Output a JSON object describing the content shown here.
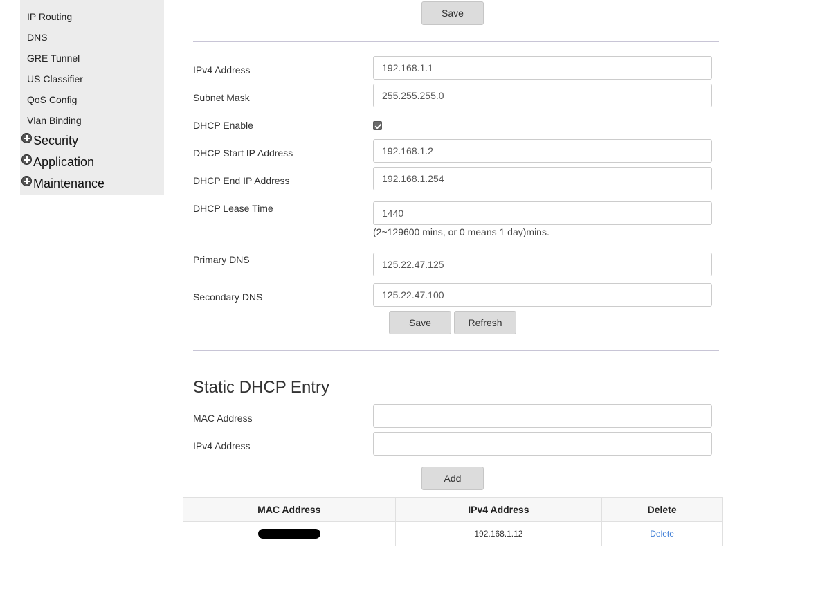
{
  "sidebar": {
    "items": [
      {
        "label": "IP Routing"
      },
      {
        "label": "DNS"
      },
      {
        "label": "GRE Tunnel"
      },
      {
        "label": "US Classifier"
      },
      {
        "label": "QoS Config"
      },
      {
        "label": "Vlan Binding"
      }
    ],
    "groups": [
      {
        "label": "Security",
        "icon": "plus-circle-icon"
      },
      {
        "label": "Application",
        "icon": "plus-circle-icon"
      },
      {
        "label": "Maintenance",
        "icon": "plus-circle-icon"
      }
    ]
  },
  "top": {
    "save_label": "Save"
  },
  "lan": {
    "ipv4_address": {
      "label": "IPv4 Address",
      "value": "192.168.1.1"
    },
    "subnet_mask": {
      "label": "Subnet Mask",
      "value": "255.255.255.0"
    },
    "dhcp_enable": {
      "label": "DHCP Enable",
      "checked": true
    },
    "dhcp_start": {
      "label": "DHCP Start IP Address",
      "value": "192.168.1.2"
    },
    "dhcp_end": {
      "label": "DHCP End IP Address",
      "value": "192.168.1.254"
    },
    "lease_time": {
      "label": "DHCP Lease Time",
      "value": "1440",
      "hint": "(2~129600 mins, or 0 means 1 day)mins."
    },
    "primary_dns": {
      "label": "Primary DNS",
      "value": "125.22.47.125"
    },
    "secondary_dns": {
      "label": "Secondary DNS",
      "value": "125.22.47.100"
    },
    "save_label": "Save",
    "refresh_label": "Refresh"
  },
  "static": {
    "title": "Static DHCP Entry",
    "mac": {
      "label": "MAC Address",
      "value": ""
    },
    "ipv4": {
      "label": "IPv4 Address",
      "value": ""
    },
    "add_label": "Add",
    "table": {
      "headers": [
        "MAC Address",
        "IPv4 Address",
        "Delete"
      ],
      "rows": [
        {
          "mac": "",
          "ipv4": "192.168.1.12",
          "action": "Delete"
        }
      ]
    }
  }
}
